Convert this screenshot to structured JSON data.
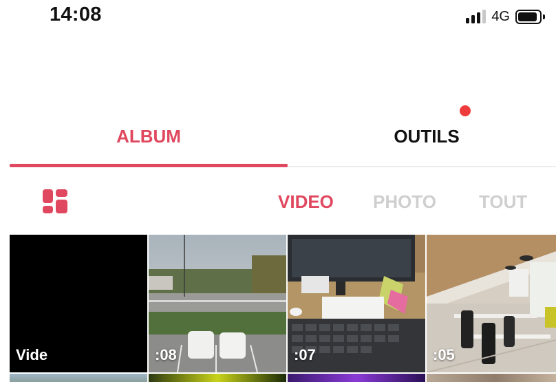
{
  "status_bar": {
    "time": "14:08",
    "network": "4G",
    "signal_bars_filled": 3,
    "signal_bars_total": 4,
    "battery_level": 0.9
  },
  "tabs": [
    {
      "label": "ALBUM",
      "active": true
    },
    {
      "label": "OUTILS",
      "active": false,
      "has_notification": true
    }
  ],
  "filters": [
    {
      "label": "VIDEO",
      "active": true
    },
    {
      "label": "PHOTO",
      "active": false
    },
    {
      "label": "TOUT",
      "active": false
    }
  ],
  "grid": {
    "items": [
      {
        "label": "Vide"
      },
      {
        "label": ":08"
      },
      {
        "label": ":07"
      },
      {
        "label": ":05"
      }
    ]
  },
  "colors": {
    "accent": "#e0485f",
    "notification": "#ee3b3b",
    "inactive_filter": "#cfcfcf",
    "text": "#111111"
  },
  "icons": [
    "signal-icon",
    "battery-icon",
    "layout-grid-icon",
    "notification-dot"
  ]
}
